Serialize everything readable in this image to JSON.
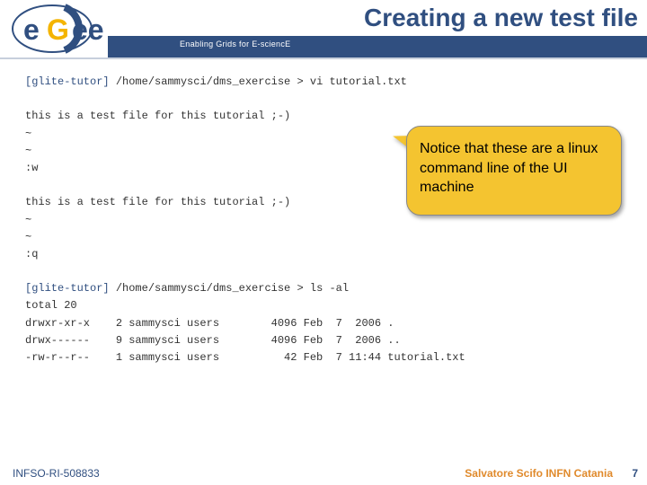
{
  "header": {
    "tagline": "Enabling Grids for E-sciencE",
    "title": "Creating a new test file",
    "logo": {
      "text_left": "e",
      "text_right": "ee",
      "letter_g": "G"
    }
  },
  "terminal": {
    "line1_prompt": "[glite-tutor] ",
    "line1_rest": "/home/sammysci/dms_exercise > vi tutorial.txt",
    "blockA": "this is a test file for this tutorial ;-)\n~\n~\n:w",
    "blockB": "this is a test file for this tutorial ;-)\n~\n~\n:q",
    "line2_prompt": "[glite-tutor] ",
    "line2_rest": "/home/sammysci/dms_exercise > ls -al",
    "ls_output": "total 20\ndrwxr-xr-x    2 sammysci users        4096 Feb  7  2006 .\ndrwx------    9 sammysci users        4096 Feb  7  2006 ..\n-rw-r--r--    1 sammysci users          42 Feb  7 11:44 tutorial.txt"
  },
  "callout": {
    "text": "Notice that these are a linux command line of the UI machine"
  },
  "footer": {
    "left": "INFSO-RI-508833",
    "right": "Salvatore Scifo INFN Catania",
    "page": "7"
  }
}
